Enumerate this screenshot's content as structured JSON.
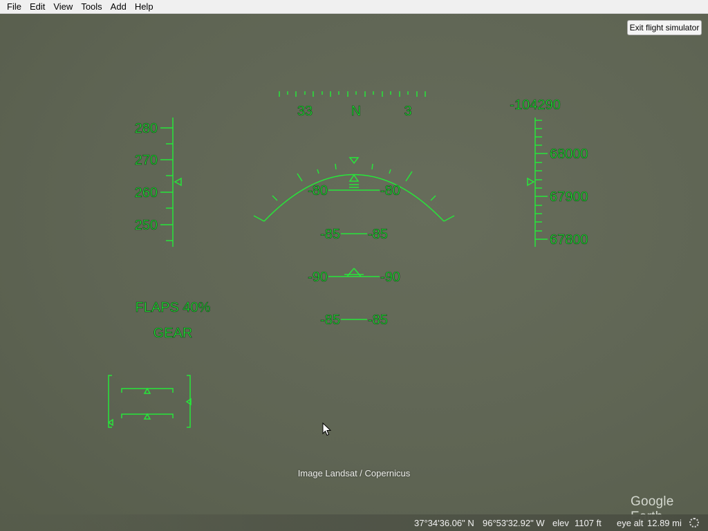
{
  "menu": {
    "file": "File",
    "edit": "Edit",
    "view": "View",
    "tools": "Tools",
    "add": "Add",
    "help": "Help"
  },
  "exit_button_label": "Exit flight simulator",
  "hud": {
    "color": "#27e63a",
    "heading": {
      "labels": [
        "33",
        "N",
        "3"
      ]
    },
    "airspeed": {
      "labels": [
        "280",
        "270",
        "260",
        "250"
      ]
    },
    "vertical_speed": "-104290",
    "altitude": {
      "labels": [
        "68000",
        "67900",
        "67800"
      ]
    },
    "pitch_ladder": [
      {
        "left": "-80",
        "right": "-80"
      },
      {
        "left": "-85",
        "right": "-85"
      },
      {
        "left": "-90",
        "right": "-90"
      },
      {
        "left": "-85",
        "right": "-85"
      }
    ],
    "flaps": "FLAPS 40%",
    "gear": "GEAR"
  },
  "attribution": "Image Landsat / Copernicus",
  "logo": "Google Earth",
  "status": {
    "latitude": "37°34'36.06\" N",
    "longitude": "96°53'32.92\" W",
    "elev_label": "elev",
    "elev_value": "1107 ft",
    "eye_alt_label": "eye alt",
    "eye_alt_value": "12.89 mi"
  }
}
